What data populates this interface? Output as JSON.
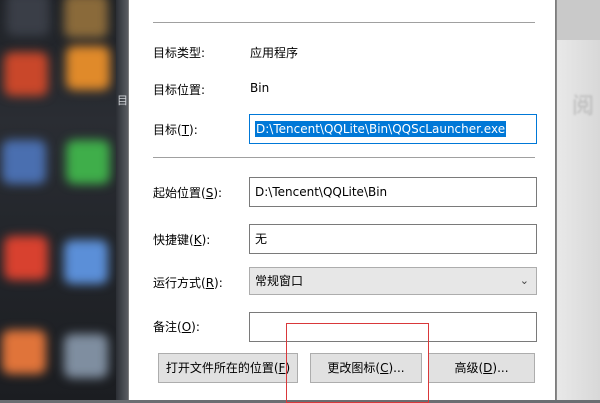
{
  "fields": {
    "target_type": {
      "label": "目标类型:",
      "value": "应用程序"
    },
    "target_location": {
      "label": "目标位置:",
      "value": "Bin"
    },
    "target": {
      "label_pre": "目标(",
      "key": "T",
      "label_post": "):",
      "value": "D:\\Tencent\\QQLite\\Bin\\QQScLauncher.exe"
    },
    "start_in": {
      "label_pre": "起始位置(",
      "key": "S",
      "label_post": "):",
      "value": "D:\\Tencent\\QQLite\\Bin"
    },
    "shortcut_key": {
      "label_pre": "快捷键(",
      "key": "K",
      "label_post": "):",
      "value": "无"
    },
    "run": {
      "label_pre": "运行方式(",
      "key": "R",
      "label_post": "):",
      "value": "常规窗口"
    },
    "comment": {
      "label_pre": "备注(",
      "key": "O",
      "label_post": "):",
      "value": ""
    }
  },
  "buttons": {
    "open_location": {
      "pre": "打开文件所在的位置(",
      "key": "F",
      "post": ")"
    },
    "change_icon": {
      "pre": "更改图标(",
      "key": "C",
      "post": ")..."
    },
    "advanced": {
      "pre": "高级(",
      "key": "D",
      "post": ")..."
    }
  },
  "background": {
    "left_fragment": "目",
    "right_fragment": "阅"
  },
  "colors": {
    "selection": "#0078d7",
    "highlight_box": "#d9383a"
  }
}
